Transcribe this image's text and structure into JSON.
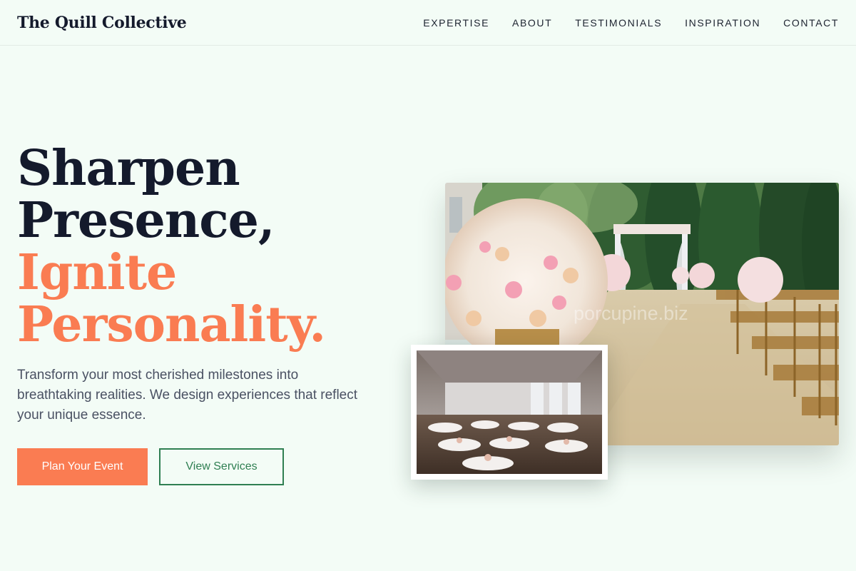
{
  "brand": "The Quill Collective",
  "nav": [
    "EXPERTISE",
    "ABOUT",
    "TESTIMONIALS",
    "INSPIRATION",
    "CONTACT"
  ],
  "hero": {
    "title_line1": "Sharpen",
    "title_line2": "Presence,",
    "title_line3": "Ignite",
    "title_line4": "Personality.",
    "description": "Transform your most cherished milestones into breathtaking realities. We design experiences that reflect your unique essence.",
    "primary_button": "Plan Your Event",
    "secondary_button": "View Services"
  },
  "images": {
    "watermark": "porcupine.biz"
  },
  "colors": {
    "background": "#f3fcf6",
    "accent": "#fa7c52",
    "secondary": "#2f7f52",
    "heading": "#141a2c"
  }
}
